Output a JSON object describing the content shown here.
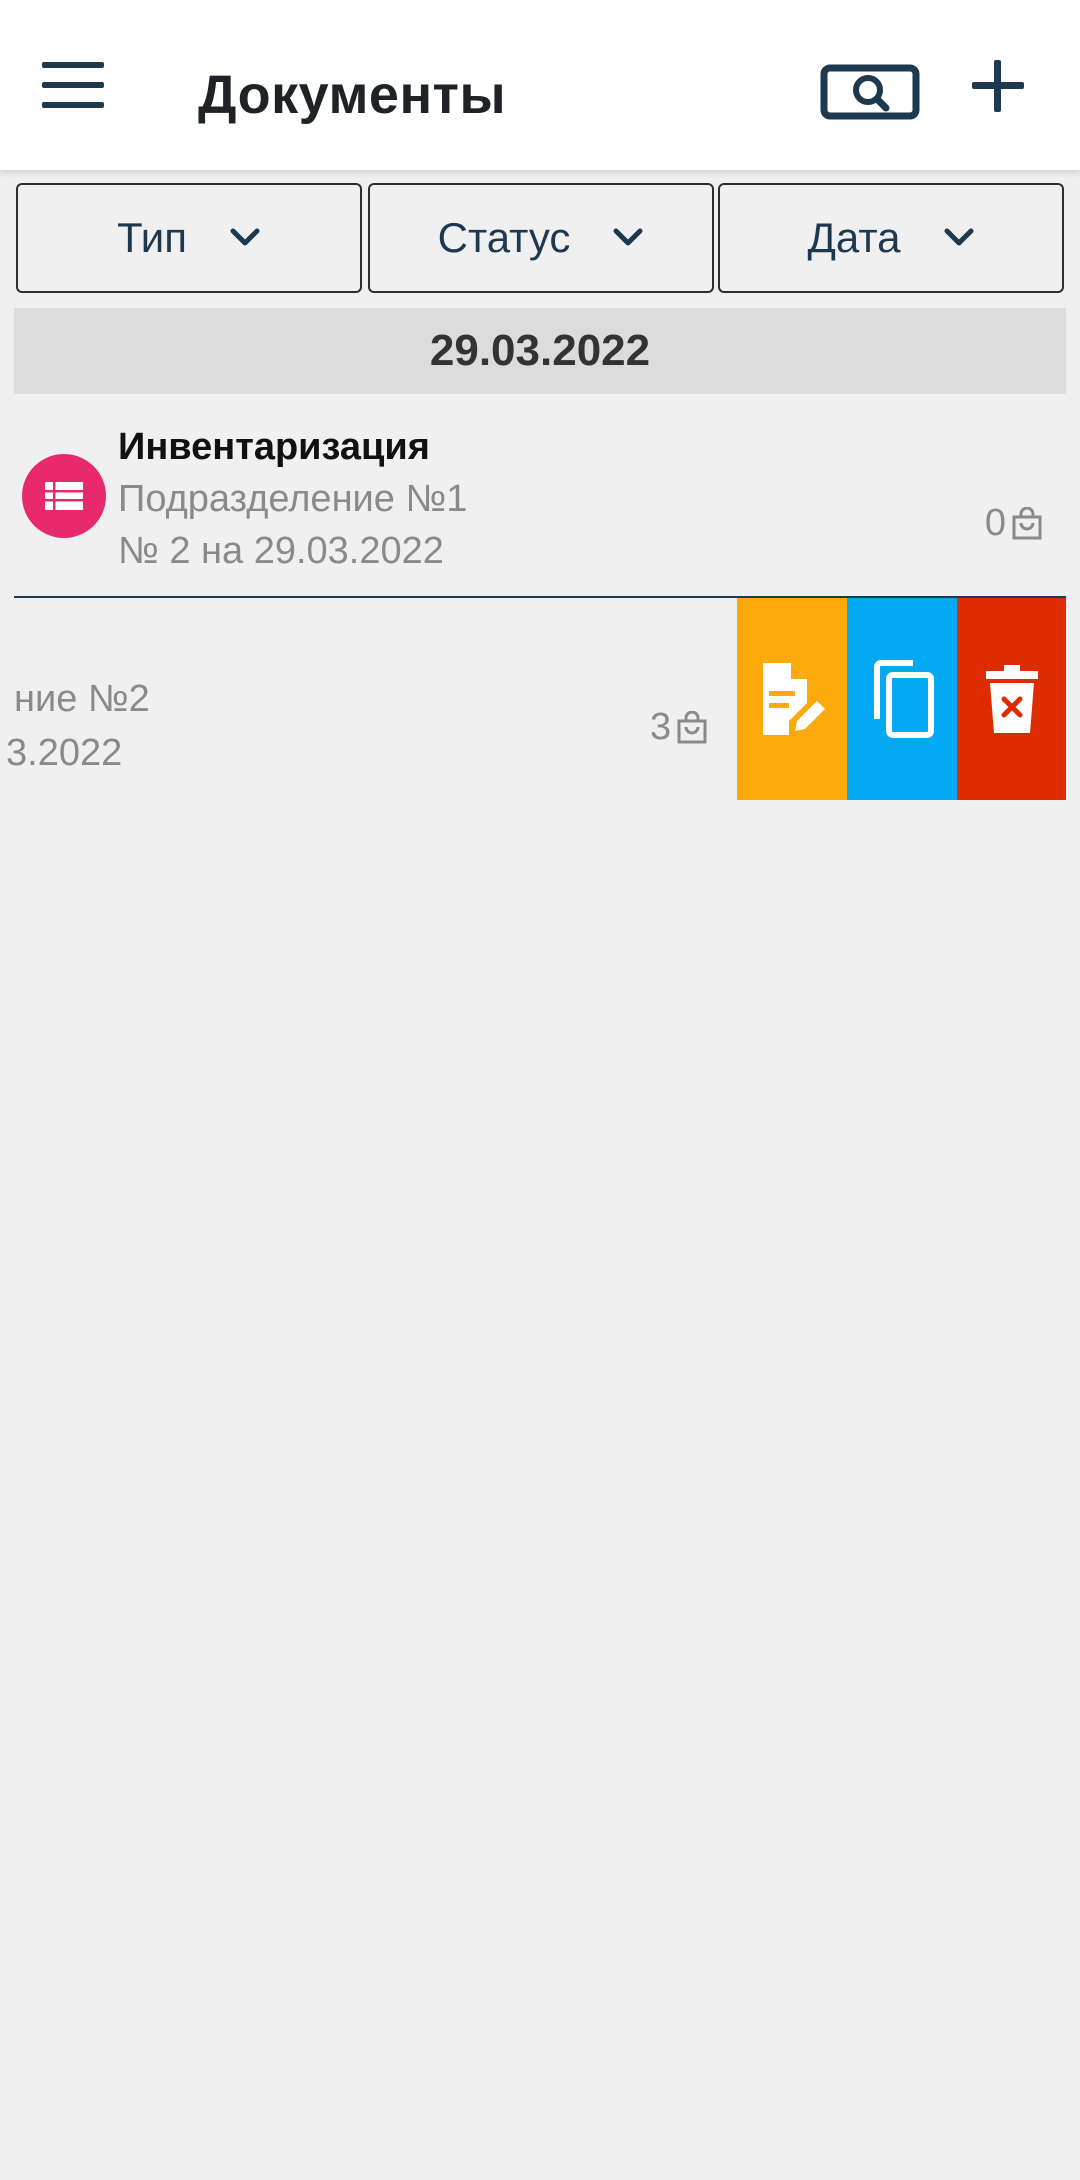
{
  "appbar": {
    "title": "Документы",
    "menu_icon": "menu-icon",
    "scan_icon": "search-barcode-icon",
    "add_icon": "plus-icon"
  },
  "filters": [
    {
      "label": "Тип"
    },
    {
      "label": "Статус"
    },
    {
      "label": "Дата"
    }
  ],
  "date_group": "29.03.2022",
  "documents": [
    {
      "title": "Инвентаризация",
      "department": "Подразделение №1",
      "number": "№ 2 на 29.03.2022",
      "quantity": "0",
      "icon": "table-list-icon",
      "icon_color": "#e8296d"
    },
    {
      "department_partial": "ние №2",
      "number_partial": "3.2022",
      "quantity": "3"
    }
  ],
  "swipe_actions": [
    {
      "name": "edit",
      "icon": "edit-document-icon",
      "color": "#fba90b"
    },
    {
      "name": "copy",
      "icon": "copy-icon",
      "color": "#04a9f4"
    },
    {
      "name": "delete",
      "icon": "delete-icon",
      "color": "#dd2c00"
    }
  ],
  "colors": {
    "accent_text": "#1e3850",
    "background": "#f0f0f0",
    "date_header_bg": "#dcdcdc"
  }
}
